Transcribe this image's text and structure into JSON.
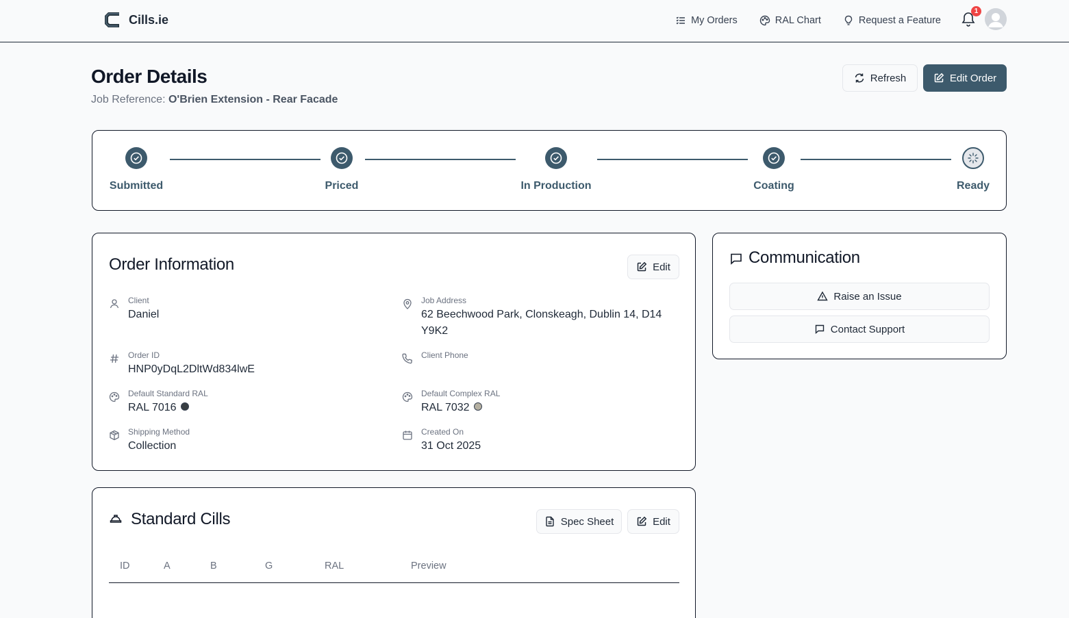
{
  "nav": {
    "brand": "Cills.ie",
    "items": [
      {
        "label": "My Orders",
        "icon": "list-icon"
      },
      {
        "label": "RAL Chart",
        "icon": "palette-icon"
      },
      {
        "label": "Request a Feature",
        "icon": "lightbulb-icon"
      }
    ],
    "notification_count": "1"
  },
  "header": {
    "title": "Order Details",
    "job_ref_label": "Job Reference:",
    "job_ref_value": "O'Brien Extension - Rear Facade",
    "refresh_label": "Refresh",
    "edit_order_label": "Edit Order"
  },
  "progress": {
    "steps": [
      {
        "label": "Submitted",
        "status": "done"
      },
      {
        "label": "Priced",
        "status": "done"
      },
      {
        "label": "In Production",
        "status": "done"
      },
      {
        "label": "Coating",
        "status": "done"
      },
      {
        "label": "Ready",
        "status": "pending"
      }
    ]
  },
  "order_info": {
    "title": "Order Information",
    "edit_label": "Edit",
    "fields": {
      "client": {
        "label": "Client",
        "value": "Daniel"
      },
      "job_address": {
        "label": "Job Address",
        "value": "62 Beechwood Park, Clonskeagh, Dublin 14, D14 Y9K2"
      },
      "order_id": {
        "label": "Order ID",
        "value": "HNP0yDqL2DltWd834lwE"
      },
      "client_phone": {
        "label": "Client Phone",
        "value": ""
      },
      "default_standard_ral": {
        "label": "Default Standard RAL",
        "value": "RAL 7016",
        "color": "#383e42"
      },
      "default_complex_ral": {
        "label": "Default Complex RAL",
        "value": "RAL 7032",
        "color": "#b5b0a1"
      },
      "shipping_method": {
        "label": "Shipping Method",
        "value": "Collection"
      },
      "created_on": {
        "label": "Created On",
        "value": "31 Oct 2025"
      }
    }
  },
  "communication": {
    "title": "Communication",
    "raise_issue_label": "Raise an Issue",
    "contact_support_label": "Contact Support"
  },
  "standard_cills": {
    "title": "Standard Cills",
    "spec_sheet_label": "Spec Sheet",
    "edit_label": "Edit",
    "columns": [
      "ID",
      "A",
      "B",
      "G",
      "RAL",
      "Preview"
    ]
  },
  "colors": {
    "primary": "#3d5a6c",
    "badge": "#ef4444"
  }
}
